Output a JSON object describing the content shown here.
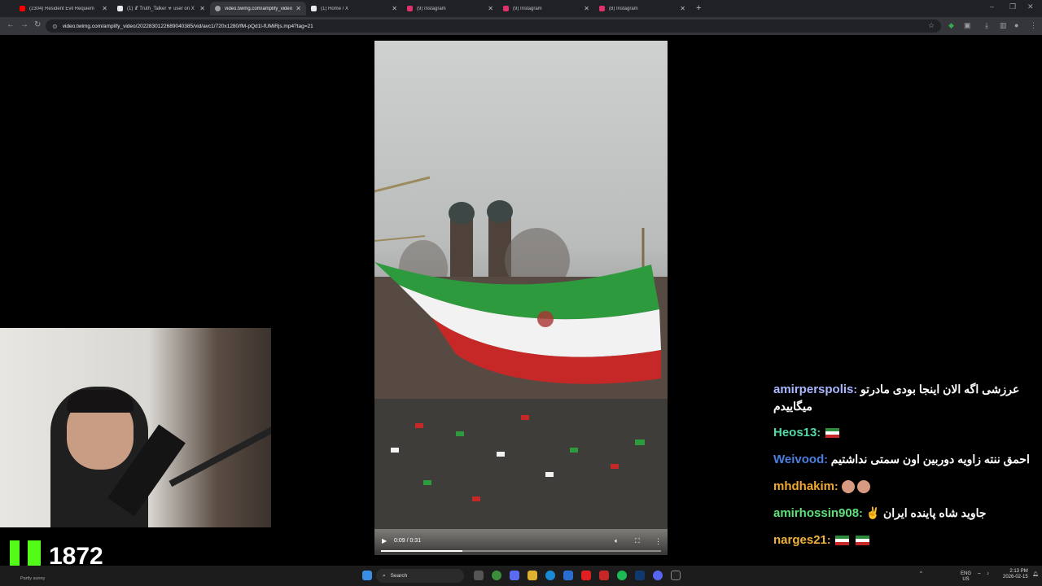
{
  "browser": {
    "tabs": [
      {
        "title": "(2304) Resident Evil Requiem",
        "color": "#ff0000",
        "active": false
      },
      {
        "title": "(1) ☧ Truth_Talker ☣ user on X",
        "color": "#e8eaed",
        "active": false
      },
      {
        "title": "video.twimg.com/amplify_video",
        "color": "#9aa0a6",
        "active": true
      },
      {
        "title": "(1) Home / X",
        "color": "#e8eaed",
        "active": false
      },
      {
        "title": "(9) Instagram",
        "color": "#e1306c",
        "active": false
      },
      {
        "title": "(9) Instagram",
        "color": "#e1306c",
        "active": false
      },
      {
        "title": "(8) Instagram",
        "color": "#e1306c",
        "active": false
      }
    ],
    "url": "video.twimg.com/amplify_video/2022830122689040385/vid/avc1/720x1280/fM-pQd1l-fUMiRjs.mp4?tag=21"
  },
  "video": {
    "time_label": "0:09 / 0:31",
    "progress": 0.29
  },
  "stream": {
    "viewer_count": "1872"
  },
  "chat": {
    "messages": [
      {
        "user": "amirperspolis",
        "user_color": "#a9b7ff",
        "text": "عرزشی اگه الان اینجا بودی مادرتو میگاییدم"
      },
      {
        "user": "Heos13",
        "user_color": "#53d8a6",
        "text": ""
      },
      {
        "user": "Weivood",
        "user_color": "#4a7fe0",
        "text": "احمق ننته زاویه دوربین اون سمتی نداشتیم"
      },
      {
        "user": "mhdhakim",
        "user_color": "#f0a830",
        "text": ""
      },
      {
        "user": "amirhossin908",
        "user_color": "#5fe07a",
        "text": "جاوید شاه پاینده ایران ✌"
      },
      {
        "user": "narges21",
        "user_color": "#f0b040",
        "text": ""
      }
    ]
  },
  "taskbar": {
    "search_placeholder": "Search",
    "weather": "Partly sunny",
    "lang": "ENG",
    "region": "US",
    "time": "2:13 PM",
    "date": "2026-02-15"
  }
}
